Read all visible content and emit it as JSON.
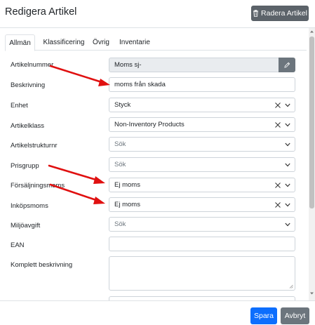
{
  "header": {
    "title": "Redigera Artikel",
    "delete_label": "Radera Artikel"
  },
  "tabs": [
    {
      "label": "Allmän",
      "active": true
    },
    {
      "label": "Klassificering",
      "active": false
    },
    {
      "label": "Övrig",
      "active": false
    },
    {
      "label": "Inventarie",
      "active": false
    }
  ],
  "form": {
    "artikelnummer": {
      "label": "Artikelnummer",
      "value": "Moms sj-"
    },
    "beskrivning": {
      "label": "Beskrivning",
      "value": "moms från skada"
    },
    "enhet": {
      "label": "Enhet",
      "value": "Styck"
    },
    "artikelklass": {
      "label": "Artikelklass",
      "value": "Non-Inventory Products"
    },
    "artikelstrukturnr": {
      "label": "Artikelstrukturnr",
      "placeholder": "Sök"
    },
    "prisgrupp": {
      "label": "Prisgrupp",
      "placeholder": "Sök"
    },
    "forsaljningsmoms": {
      "label": "Försäljningsmoms",
      "value": "Ej moms"
    },
    "inkopsmoms": {
      "label": "Inköpsmoms",
      "value": "Ej moms"
    },
    "miljoavgift": {
      "label": "Miljöavgift",
      "placeholder": "Sök"
    },
    "ean": {
      "label": "EAN",
      "value": ""
    },
    "komplett_beskrivning": {
      "label": "Komplett beskrivning",
      "value": ""
    }
  },
  "footer": {
    "save_label": "Spara",
    "cancel_label": "Avbryt"
  },
  "colors": {
    "primary": "#0d6efd",
    "secondary": "#6c757d",
    "annotation_arrow": "#e01010"
  },
  "icons": {
    "delete": "trash-icon",
    "edit": "pencil-icon",
    "clear": "clear-x-icon",
    "dropdown": "chevron-down-icon"
  }
}
